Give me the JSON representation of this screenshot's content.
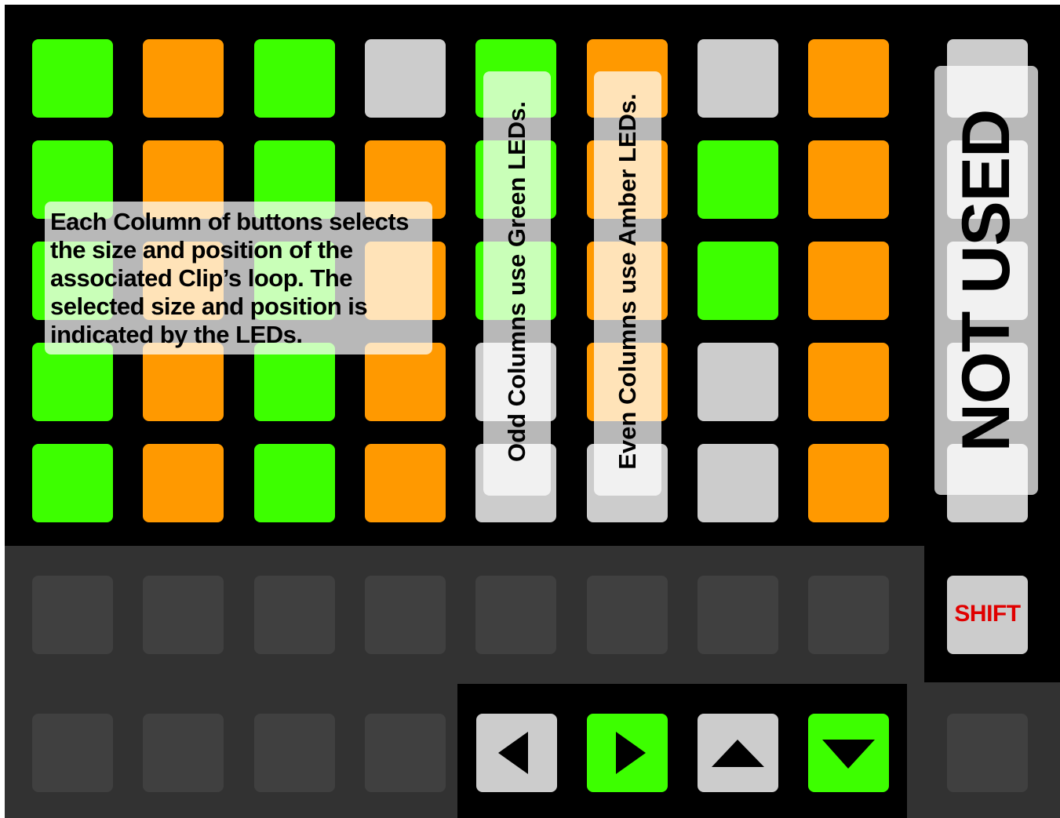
{
  "colors": {
    "green": "#3dff00",
    "amber": "#ff9900",
    "off": "#cccccc",
    "dark_pad": "#404040",
    "panel": "#323232",
    "shift_text": "#e00000"
  },
  "grid": [
    [
      "green",
      "amber",
      "green",
      "off",
      "green",
      "amber",
      "off",
      "amber",
      "off"
    ],
    [
      "green",
      "amber",
      "green",
      "amber",
      "green",
      "amber",
      "green",
      "amber",
      "off"
    ],
    [
      "green",
      "amber",
      "green",
      "amber",
      "green",
      "amber",
      "green",
      "amber",
      "off"
    ],
    [
      "green",
      "amber",
      "green",
      "amber",
      "off",
      "amber",
      "off",
      "amber",
      "off"
    ],
    [
      "green",
      "amber",
      "green",
      "amber",
      "off",
      "off",
      "off",
      "amber",
      "off"
    ]
  ],
  "notes": {
    "main": [
      "Each Column of buttons selects",
      "the size and position of the",
      "associated Clip’s loop. The",
      "selected size and position is",
      "indicated by the LEDs."
    ],
    "odd_columns": "Odd Columns use Green LEDs.",
    "even_columns": "Even Columns use Amber LEDs.",
    "not_used": "NOT USED"
  },
  "shift_button": {
    "label": "SHIFT"
  },
  "nav_buttons": [
    {
      "icon": "arrow-left-icon",
      "state": "off"
    },
    {
      "icon": "arrow-right-icon",
      "state": "green"
    },
    {
      "icon": "arrow-up-icon",
      "state": "off"
    },
    {
      "icon": "arrow-down-icon",
      "state": "green"
    }
  ]
}
